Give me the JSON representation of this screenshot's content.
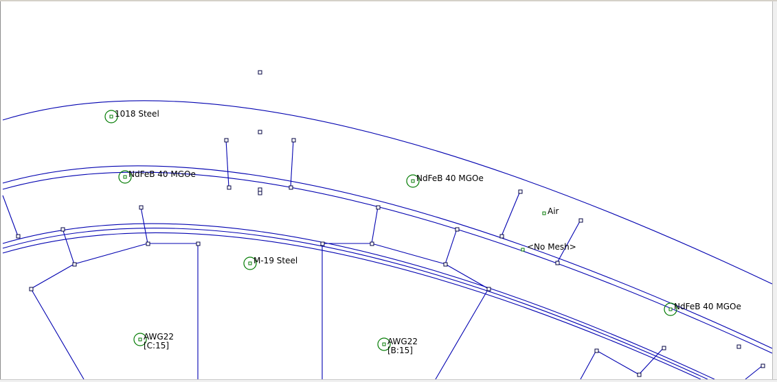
{
  "block_labels": [
    {
      "id": "outer-steel",
      "text": "1018 Steel"
    },
    {
      "id": "magnet-1",
      "text": "NdFeB 40 MGOe"
    },
    {
      "id": "magnet-2",
      "text": "NdFeB 40 MGOe"
    },
    {
      "id": "magnet-3",
      "text": "NdFeB 40 MGOe"
    },
    {
      "id": "air",
      "text": "Air"
    },
    {
      "id": "no-mesh",
      "text": "<No Mesh>"
    },
    {
      "id": "stator-steel",
      "text": "M-19 Steel"
    },
    {
      "id": "coil-c",
      "text": "AWG22",
      "circuit": "[C:15]"
    },
    {
      "id": "coil-b",
      "text": "AWG22",
      "circuit": "[B:15]"
    }
  ],
  "colors": {
    "geometry_line": "#0000b0",
    "node_marker": "#000040",
    "block_label_marker": "#007a00",
    "background": "#ffffff"
  }
}
